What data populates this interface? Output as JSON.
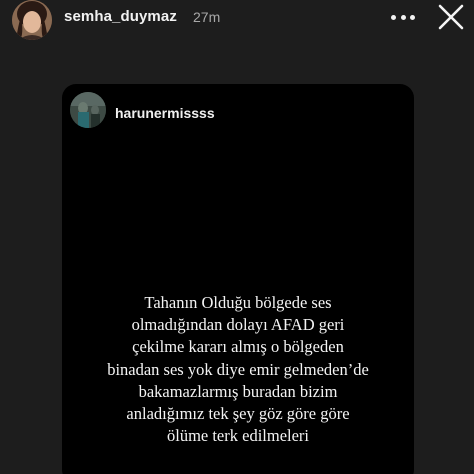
{
  "story_header": {
    "username": "semha_duymaz",
    "time_ago": "27m",
    "more_icon": "more-horizontal-icon",
    "close_icon": "close-icon"
  },
  "shared_post": {
    "username": "harunermissss",
    "text_lines": [
      "Tahanın Olduğu bölgede ses",
      "olmadığından dolayı AFAD geri",
      "çekilme kararı almış o bölgeden",
      "binadan ses yok diye emir gelmeden’de",
      "bakamazlarmış buradan bizim",
      "anladığımız tek şey göz göre göre",
      "ölüme terk edilmeleri"
    ]
  },
  "colors": {
    "story_background": "#1d1d1d",
    "card_background": "#000000",
    "text_primary": "#f2f2f2",
    "text_secondary": "#a8a8a8"
  }
}
